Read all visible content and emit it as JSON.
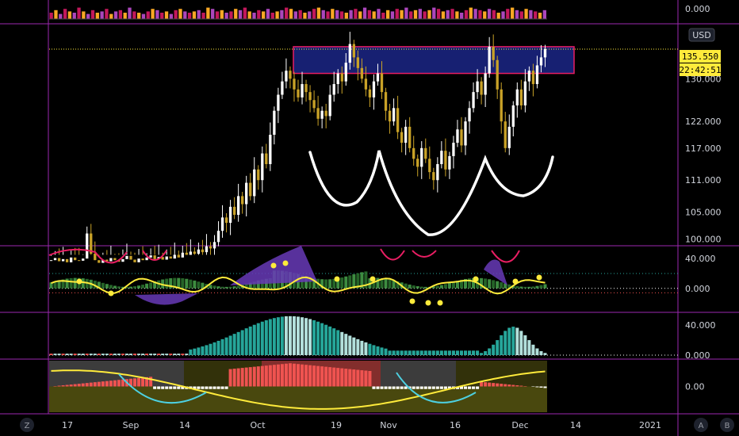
{
  "currency": "USD",
  "price_tag": "135.550",
  "countdown_tag": "22:42:51",
  "buttons": {
    "left": "Z",
    "auto": "A",
    "log": "B"
  },
  "colors": {
    "background": "#000000",
    "panel_border": "#9c27b0",
    "bull_candle": "#ffffff",
    "bear_candle": "#c9a227",
    "price_tag": "#ffeb3b",
    "resistance_zone": "#1a237e",
    "resistance_border": "#e91e63",
    "pattern_line": "#ffffff",
    "teal": "#26a69a",
    "mint": "#b2dfdb",
    "red": "#ef5350",
    "olive": "#5b5a12",
    "grey": "#6d6d6d",
    "yellow": "#ffeb3b",
    "purple": "#673ab7",
    "pink": "#e91e63",
    "cyan": "#4dd0e1"
  },
  "chart_data": [
    {
      "type": "bar",
      "panel": "volume strip",
      "y_ticks": [
        "0.000"
      ],
      "note_values_relative": [
        0.5,
        0.7,
        0.4,
        0.8,
        0.6,
        0.5,
        0.9,
        0.6,
        0.4,
        0.7,
        0.5,
        0.6,
        0.8,
        0.4,
        0.6,
        0.7,
        0.5,
        0.9,
        0.6,
        0.5,
        0.4,
        0.6,
        0.8,
        0.7,
        0.5,
        0.6,
        0.4,
        0.7,
        0.8,
        0.6,
        0.5,
        0.6,
        0.7,
        0.5,
        0.9,
        0.8,
        0.6,
        0.7,
        0.5,
        0.6,
        0.8,
        0.7,
        0.9,
        0.6,
        0.5,
        0.7,
        0.6,
        0.8,
        0.5,
        0.6,
        0.7,
        0.9,
        0.8,
        0.6,
        0.7,
        0.5,
        0.6,
        0.8,
        0.9,
        0.7,
        0.6,
        0.8,
        0.7,
        0.6,
        0.5,
        0.7,
        0.8,
        0.6,
        0.9,
        0.7,
        0.6,
        0.8,
        0.5,
        0.7,
        0.6,
        0.8,
        0.7,
        0.9,
        0.6,
        0.7,
        0.8,
        0.6,
        0.7,
        0.9,
        0.8,
        0.6,
        0.7,
        0.8,
        0.6,
        0.5,
        0.7,
        0.9,
        0.8,
        0.7,
        0.6,
        0.8,
        0.7,
        0.5,
        0.6,
        0.8,
        0.9,
        0.7,
        0.6,
        0.8,
        0.7,
        0.6,
        0.5,
        0.7
      ]
    },
    {
      "type": "candlestick",
      "panel": "price",
      "y_ticks": [
        "130.000",
        "122.000",
        "117.000",
        "111.000",
        "105.000",
        "100.000"
      ],
      "ylim": [
        99,
        140
      ],
      "x_labels": [
        "17",
        "Sep",
        "14",
        "Oct",
        "19",
        "Nov",
        "16",
        "Dec",
        "14",
        "2021"
      ],
      "last_price": 135.55,
      "resistance_zone": [
        131.0,
        136.0
      ],
      "closes": [
        96,
        96.4,
        95.8,
        96.2,
        95.6,
        96.5,
        96.0,
        95.9,
        96.3,
        101.0,
        97.2,
        96.0,
        95.5,
        96.1,
        95.8,
        96.4,
        96.0,
        95.7,
        96.2,
        96.8,
        96.1,
        95.6,
        96.3,
        96.0,
        96.5,
        96.9,
        96.2,
        96.6,
        96.1,
        96.7,
        96.3,
        97.0,
        96.5,
        97.4,
        97.0,
        97.6,
        97.2,
        98.0,
        97.5,
        98.6,
        98.2,
        99.4,
        101.5,
        104.0,
        103.0,
        106.0,
        104.5,
        108.0,
        106.5,
        110.5,
        108.0,
        113.0,
        111.0,
        116.0,
        114.0,
        119.5,
        124.0,
        127.0,
        129.5,
        131.5,
        130.0,
        128.0,
        126.5,
        129.0,
        127.5,
        126.0,
        124.5,
        122.5,
        124.0,
        123.0,
        127.0,
        129.0,
        131.0,
        129.5,
        133.0,
        136.5,
        134.0,
        132.0,
        130.0,
        128.0,
        126.5,
        129.5,
        131.0,
        127.5,
        124.0,
        122.0,
        124.5,
        120.0,
        118.0,
        121.0,
        117.0,
        115.0,
        113.5,
        117.0,
        115.0,
        112.5,
        111.0,
        114.0,
        116.5,
        113.0,
        115.5,
        118.0,
        120.5,
        117.5,
        122.0,
        124.5,
        127.5,
        129.5,
        127.0,
        131.0,
        136.0,
        133.5,
        128.0,
        122.0,
        117.0,
        121.0,
        125.0,
        128.0,
        125.0,
        129.5,
        131.5,
        129.0,
        132.5,
        134.0,
        135.55
      ]
    },
    {
      "type": "bar",
      "panel": "oscillator 1",
      "y_ticks": [
        "40.000",
        "0.000"
      ],
      "ylim": [
        -30,
        55
      ]
    },
    {
      "type": "bar",
      "panel": "oscillator 2",
      "y_ticks": [
        "40.000",
        "0.000"
      ],
      "ylim": [
        0,
        55
      ]
    },
    {
      "type": "bar",
      "panel": "oscillator 3",
      "y_ticks": [
        "0.00"
      ],
      "ylim": [
        -40,
        40
      ]
    }
  ]
}
